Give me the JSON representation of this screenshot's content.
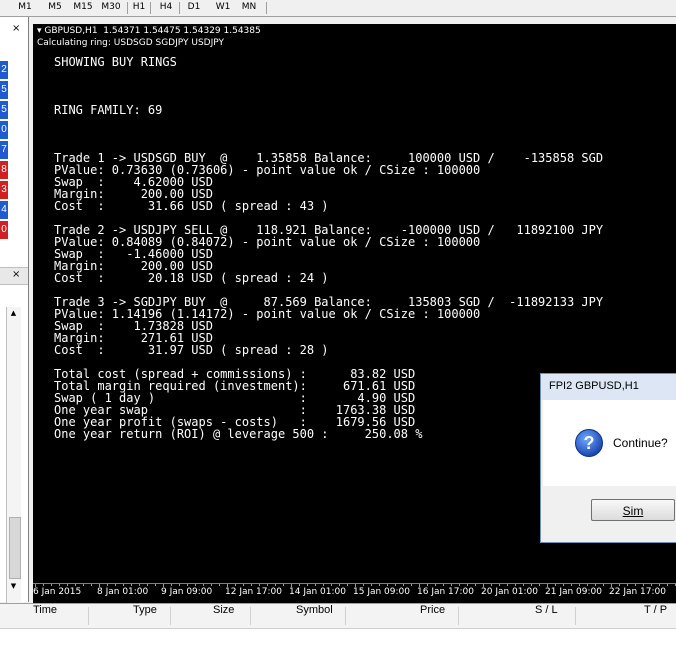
{
  "timeframes": [
    "M1",
    "M5",
    "M15",
    "M30",
    "H1",
    "H4",
    "D1",
    "W1",
    "MN"
  ],
  "left_numbers": [
    {
      "text": "2",
      "color": "#1e5ad0"
    },
    {
      "text": "5",
      "color": "#1e5ad0"
    },
    {
      "text": "5",
      "color": "#1e5ad0"
    },
    {
      "text": "0",
      "color": "#1e5ad0"
    },
    {
      "text": "7",
      "color": "#1e5ad0"
    },
    {
      "text": "8",
      "color": "#d02020"
    },
    {
      "text": "3",
      "color": "#d02020"
    },
    {
      "text": "4",
      "color": "#1e5ad0"
    },
    {
      "text": "0",
      "color": "#d02020"
    }
  ],
  "chart": {
    "title": "GBPUSD,H1  1.54371 1.54475 1.54329 1.54385",
    "subtitle": "Calculating ring: USDSGD SGDJPY USDJPY",
    "comment_lines": [
      "SHOWING BUY RINGS",
      "",
      "",
      "",
      "RING FAMILY: 69",
      "",
      "",
      "",
      "Trade 1 -> USDSGD BUY  @    1.35858 Balance:     100000 USD /    -135858 SGD",
      "PValue: 0.73630 (0.73606) - point value ok / CSize : 100000",
      "Swap  :    4.62000 USD",
      "Margin:     200.00 USD",
      "Cost  :      31.66 USD ( spread : 43 )",
      "",
      "Trade 2 -> USDJPY SELL @    118.921 Balance:    -100000 USD /   11892100 JPY",
      "PValue: 0.84089 (0.84072) - point value ok / CSize : 100000",
      "Swap  :   -1.46000 USD",
      "Margin:     200.00 USD",
      "Cost  :      20.18 USD ( spread : 24 )",
      "",
      "Trade 3 -> SGDJPY BUY  @     87.569 Balance:     135803 SGD /  -11892133 JPY",
      "PValue: 1.14196 (1.14172) - point value ok / CSize : 100000",
      "Swap  :    1.73828 USD",
      "Margin:     271.61 USD",
      "Cost  :      31.97 USD ( spread : 28 )",
      "",
      "Total cost (spread + commissions) :      83.82 USD",
      "Total margin required (investment):     671.61 USD",
      "Swap ( 1 day )                    :       4.90 USD",
      "One year swap                     :    1763.38 USD",
      "One year profit (swaps - costs)   :    1679.56 USD",
      "One year return (ROI) @ leverage 500 :     250.08 %"
    ]
  },
  "time_axis": [
    "6 Jan 2015",
    "8 Jan 01:00",
    "9 Jan 09:00",
    "12 Jan 17:00",
    "14 Jan 01:00",
    "15 Jan 09:00",
    "16 Jan 17:00",
    "20 Jan 01:00",
    "21 Jan 09:00",
    "22 Jan 17:00"
  ],
  "terminal_columns": [
    "Time",
    "Type",
    "Size",
    "Symbol",
    "Price",
    "S / L",
    "T / P"
  ],
  "dialog": {
    "title": "FPI2 GBPUSD,H1",
    "message": "Continue?",
    "yes_button": "Sim",
    "icon": "question-icon"
  }
}
